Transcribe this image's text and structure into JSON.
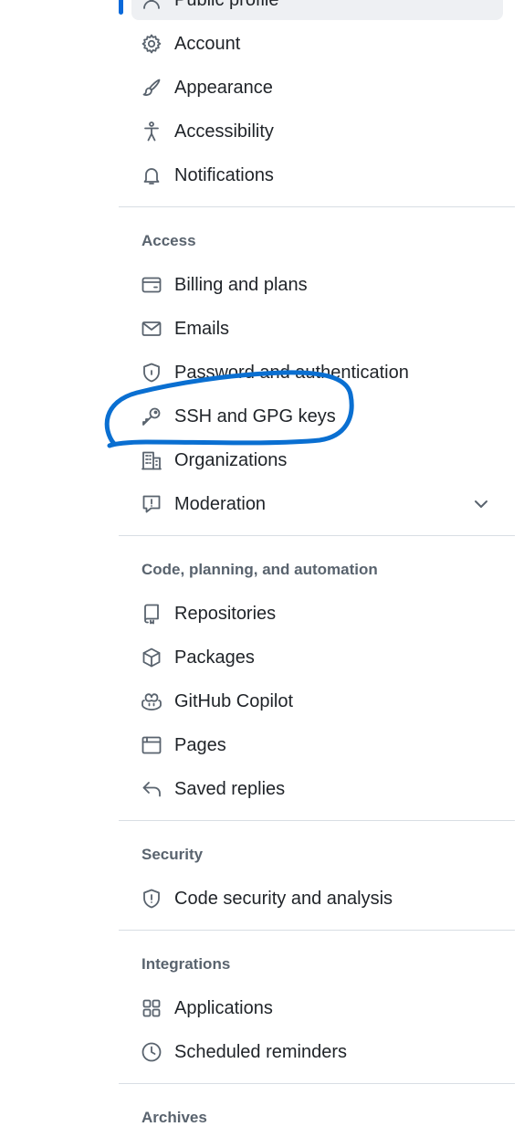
{
  "top_items": [
    {
      "label": "Public profile",
      "icon": "person-icon"
    },
    {
      "label": "Account",
      "icon": "gear-icon"
    },
    {
      "label": "Appearance",
      "icon": "paintbrush-icon"
    },
    {
      "label": "Accessibility",
      "icon": "accessibility-icon"
    },
    {
      "label": "Notifications",
      "icon": "bell-icon"
    }
  ],
  "sections": {
    "access": {
      "heading": "Access",
      "items": [
        {
          "label": "Billing and plans",
          "icon": "credit-card-icon"
        },
        {
          "label": "Emails",
          "icon": "mail-icon"
        },
        {
          "label": "Password and authentication",
          "icon": "shield-lock-icon"
        },
        {
          "label": "SSH and GPG keys",
          "icon": "key-icon"
        },
        {
          "label": "Organizations",
          "icon": "organization-icon"
        },
        {
          "label": "Moderation",
          "icon": "report-icon",
          "expandable": true
        }
      ]
    },
    "code": {
      "heading": "Code, planning, and automation",
      "items": [
        {
          "label": "Repositories",
          "icon": "repo-icon"
        },
        {
          "label": "Packages",
          "icon": "package-icon"
        },
        {
          "label": "GitHub Copilot",
          "icon": "copilot-icon"
        },
        {
          "label": "Pages",
          "icon": "browser-icon"
        },
        {
          "label": "Saved replies",
          "icon": "reply-icon"
        }
      ]
    },
    "security": {
      "heading": "Security",
      "items": [
        {
          "label": "Code security and analysis",
          "icon": "shield-icon"
        }
      ]
    },
    "integrations": {
      "heading": "Integrations",
      "items": [
        {
          "label": "Applications",
          "icon": "apps-icon"
        },
        {
          "label": "Scheduled reminders",
          "icon": "clock-icon"
        }
      ]
    },
    "archives": {
      "heading": "Archives"
    }
  },
  "active_item": "Public profile",
  "annotation": {
    "color": "#0a6fd1",
    "encircles": "SSH and GPG keys"
  },
  "colors": {
    "accent": "#0969da",
    "icon": "#59636e",
    "text": "#1f2328",
    "divider": "#d8dee4"
  }
}
